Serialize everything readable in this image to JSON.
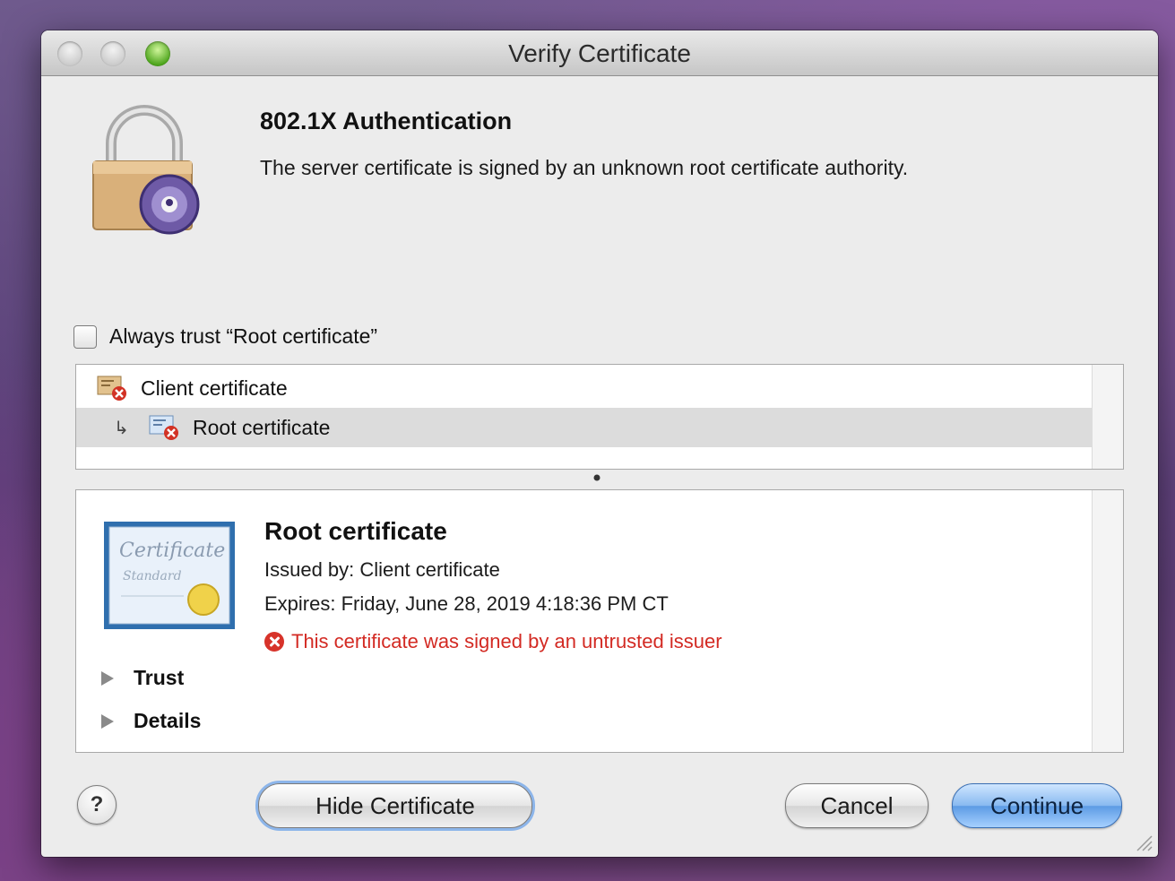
{
  "window": {
    "title": "Verify Certificate"
  },
  "header": {
    "heading": "802.1X Authentication",
    "message": "The server certificate is signed by an unknown root certificate authority."
  },
  "trust_option": {
    "label": "Always trust “Root certificate”",
    "checked": false
  },
  "cert_tree": {
    "items": [
      {
        "label": "Client certificate",
        "selected": false
      },
      {
        "label": "Root certificate",
        "selected": true
      }
    ]
  },
  "detail": {
    "title": "Root certificate",
    "issued_by": "Issued by: Client certificate",
    "expires": "Expires: Friday, June 28, 2019 4:18:36 PM CT",
    "warning": "This certificate was signed by an untrusted issuer",
    "sections": [
      {
        "label": "Trust"
      },
      {
        "label": "Details"
      }
    ]
  },
  "buttons": {
    "help": "?",
    "hide_certificate": "Hide Certificate",
    "cancel": "Cancel",
    "continue": "Continue"
  },
  "colors": {
    "warning": "#d32a23",
    "default_button": "#5c9be4",
    "selection": "#dcdcdc"
  }
}
